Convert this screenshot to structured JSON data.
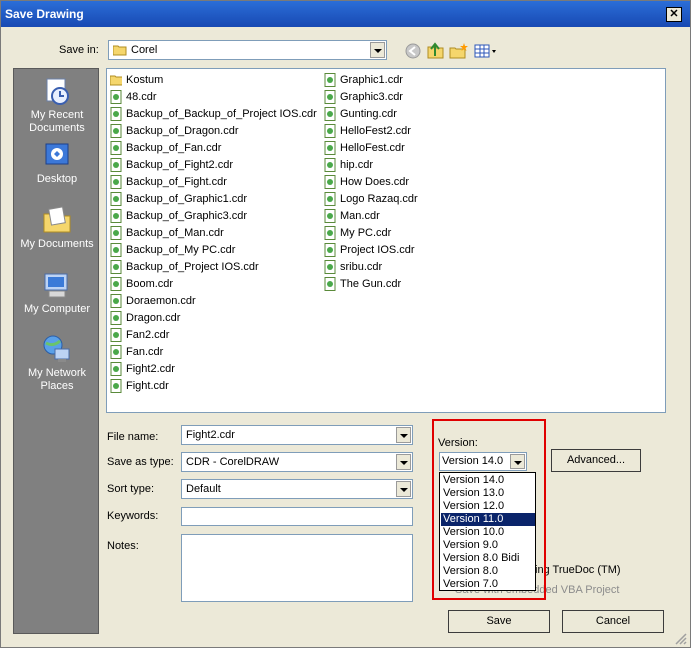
{
  "window": {
    "title": "Save Drawing"
  },
  "save_in": {
    "label": "Save in:",
    "value": "Corel"
  },
  "places": [
    {
      "label": "My Recent Documents",
      "icon": "recent-documents-icon"
    },
    {
      "label": "Desktop",
      "icon": "desktop-icon"
    },
    {
      "label": "My Documents",
      "icon": "my-documents-icon"
    },
    {
      "label": "My Computer",
      "icon": "my-computer-icon"
    },
    {
      "label": "My Network Places",
      "icon": "network-places-icon"
    }
  ],
  "files_col1": [
    "Kostum",
    "48.cdr",
    "Backup_of_Backup_of_Project IOS.cdr",
    "Backup_of_Dragon.cdr",
    "Backup_of_Fan.cdr",
    "Backup_of_Fight2.cdr",
    "Backup_of_Fight.cdr",
    "Backup_of_Graphic1.cdr",
    "Backup_of_Graphic3.cdr",
    "Backup_of_Man.cdr",
    "Backup_of_My PC.cdr",
    "Backup_of_Project IOS.cdr",
    "Boom.cdr",
    "Doraemon.cdr",
    "Dragon.cdr",
    "Fan2.cdr",
    "Fan.cdr",
    "Fight2.cdr",
    "Fight.cdr"
  ],
  "files_col2": [
    "Graphic1.cdr",
    "Graphic3.cdr",
    "Gunting.cdr",
    "HelloFest2.cdr",
    "HelloFest.cdr",
    "hip.cdr",
    "How Does.cdr",
    "Logo Razaq.cdr",
    "Man.cdr",
    "My PC.cdr",
    "Project IOS.cdr",
    "sribu.cdr",
    "The Gun.cdr"
  ],
  "form": {
    "file_name_label": "File name:",
    "file_name_value": "Fight2.cdr",
    "save_type_label": "Save as type:",
    "save_type_value": "CDR - CorelDRAW",
    "sort_label": "Sort type:",
    "sort_value": "Default",
    "keywords_label": "Keywords:",
    "keywords_value": "",
    "notes_label": "Notes:",
    "notes_value": ""
  },
  "version": {
    "label": "Version:",
    "selected": "Version 14.0",
    "options": [
      "Version 14.0",
      "Version 13.0",
      "Version 12.0",
      "Version 11.0",
      "Version 10.0",
      "Version 9.0",
      "Version 8.0 Bidi",
      "Version 8.0",
      "Version 7.0"
    ],
    "highlighted": "Version 11.0"
  },
  "advanced_button": "Advanced...",
  "truedoc_text": "ing TrueDoc (TM)",
  "vba_text": "Save with embedded VBA Project",
  "save_button": "Save",
  "cancel_button": "Cancel",
  "colors": {
    "title_bar": "#1849b3",
    "highlight": "#0a246a",
    "callout": "#e00000"
  }
}
